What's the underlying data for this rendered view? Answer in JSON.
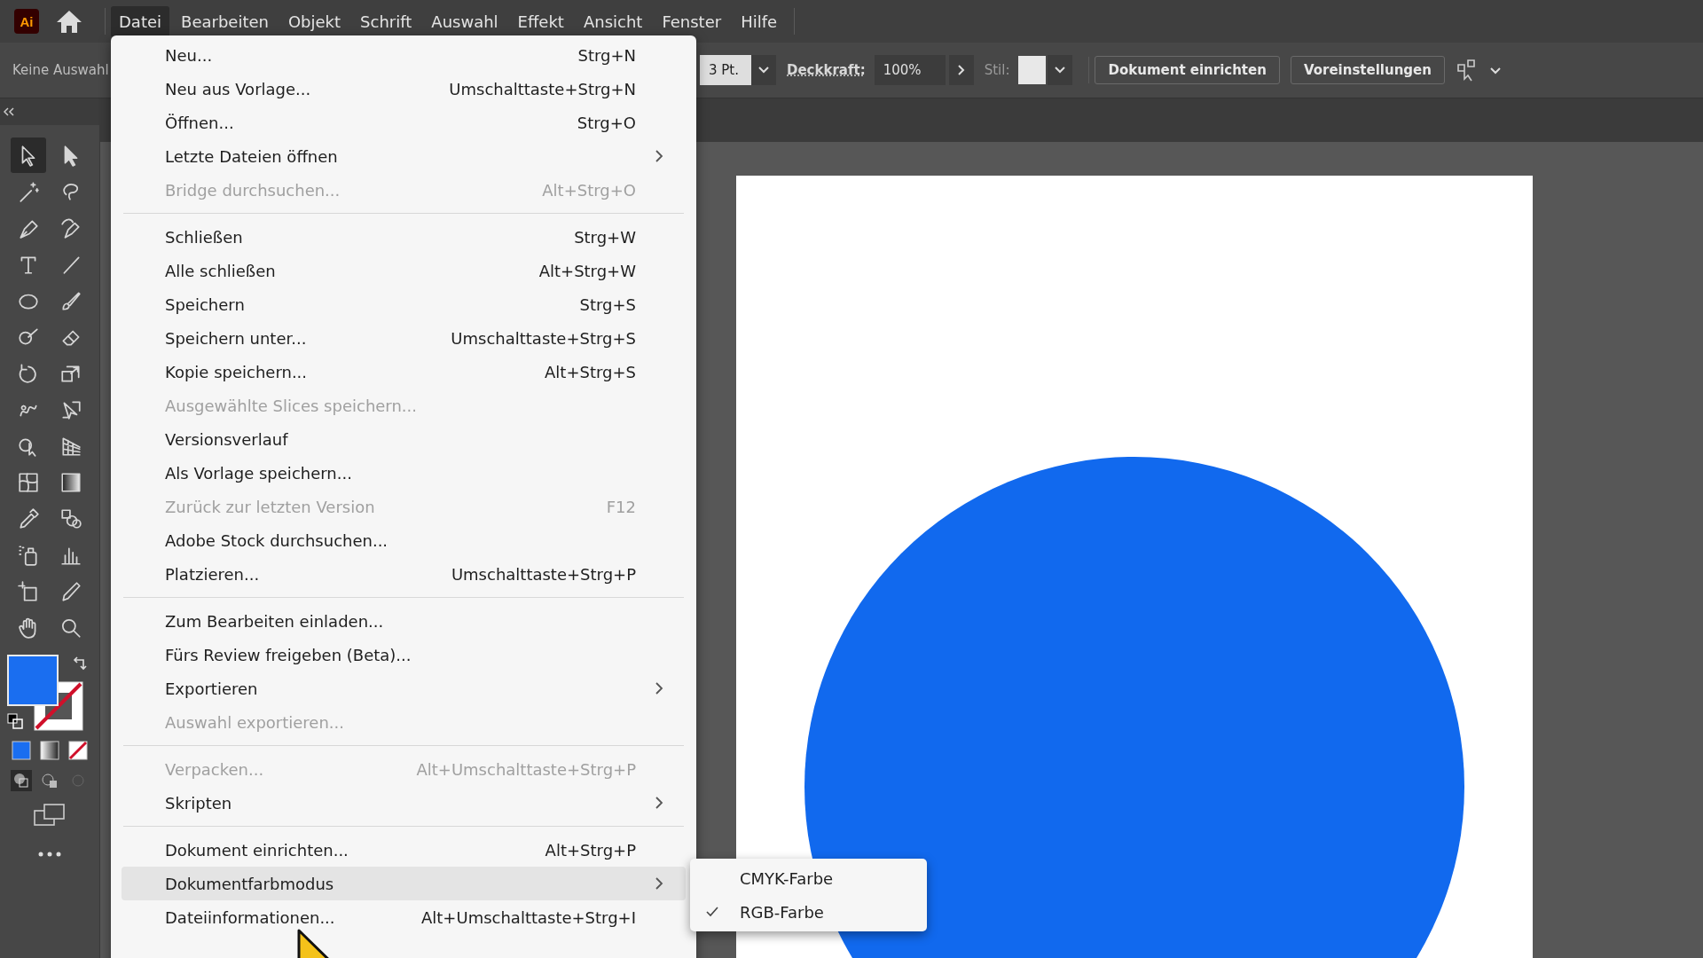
{
  "app_logo": "Ai",
  "menubar": [
    {
      "label": "Datei",
      "selected": true
    },
    {
      "label": "Bearbeiten",
      "selected": false
    },
    {
      "label": "Objekt",
      "selected": false
    },
    {
      "label": "Schrift",
      "selected": false
    },
    {
      "label": "Auswahl",
      "selected": false
    },
    {
      "label": "Effekt",
      "selected": false
    },
    {
      "label": "Ansicht",
      "selected": false
    },
    {
      "label": "Fenster",
      "selected": false
    },
    {
      "label": "Hilfe",
      "selected": false
    }
  ],
  "control_bar": {
    "selection": "Keine Auswahl",
    "stroke_weight": "3 Pt.",
    "opacity_label": "Deckkraft:",
    "opacity": "100%",
    "style_label": "Stil:",
    "buttons": [
      "Dokument einrichten",
      "Voreinstellungen"
    ]
  },
  "tools": [
    {
      "selected": true
    },
    {
      "selected": false
    },
    {
      "selected": false
    },
    {
      "selected": false
    },
    {
      "selected": false
    },
    {
      "selected": false
    },
    {
      "selected": false
    },
    {
      "selected": false
    },
    {
      "selected": false
    },
    {
      "selected": false
    },
    {
      "selected": false
    },
    {
      "selected": false
    },
    {
      "selected": false
    },
    {
      "selected": false
    },
    {
      "selected": false
    },
    {
      "selected": false
    },
    {
      "selected": false
    },
    {
      "selected": false
    },
    {
      "selected": false
    },
    {
      "selected": false
    },
    {
      "selected": false
    },
    {
      "selected": false
    },
    {
      "selected": false
    },
    {
      "selected": false
    },
    {
      "selected": false
    },
    {
      "selected": false
    },
    {
      "selected": false
    },
    {
      "selected": false
    }
  ],
  "file_menu": [
    {
      "kind": "item",
      "label": "Neu...",
      "shortcut": "Strg+N",
      "disabled": false,
      "submenu": false,
      "highlighted": false
    },
    {
      "kind": "item",
      "label": "Neu aus Vorlage...",
      "shortcut": "Umschalttaste+Strg+N",
      "disabled": false,
      "submenu": false,
      "highlighted": false
    },
    {
      "kind": "item",
      "label": "Öffnen...",
      "shortcut": "Strg+O",
      "disabled": false,
      "submenu": false,
      "highlighted": false
    },
    {
      "kind": "item",
      "label": "Letzte Dateien öffnen",
      "disabled": false,
      "submenu": true,
      "highlighted": false
    },
    {
      "kind": "item",
      "label": "Bridge durchsuchen...",
      "shortcut": "Alt+Strg+O",
      "disabled": true,
      "submenu": false,
      "highlighted": false
    },
    {
      "kind": "separator"
    },
    {
      "kind": "item",
      "label": "Schließen",
      "shortcut": "Strg+W",
      "disabled": false,
      "submenu": false,
      "highlighted": false
    },
    {
      "kind": "item",
      "label": "Alle schließen",
      "shortcut": "Alt+Strg+W",
      "disabled": false,
      "submenu": false,
      "highlighted": false
    },
    {
      "kind": "item",
      "label": "Speichern",
      "shortcut": "Strg+S",
      "disabled": false,
      "submenu": false,
      "highlighted": false
    },
    {
      "kind": "item",
      "label": "Speichern unter...",
      "shortcut": "Umschalttaste+Strg+S",
      "disabled": false,
      "submenu": false,
      "highlighted": false
    },
    {
      "kind": "item",
      "label": "Kopie speichern...",
      "shortcut": "Alt+Strg+S",
      "disabled": false,
      "submenu": false,
      "highlighted": false
    },
    {
      "kind": "item",
      "label": "Ausgewählte Slices speichern...",
      "disabled": true,
      "submenu": false,
      "highlighted": false
    },
    {
      "kind": "item",
      "label": "Versionsverlauf",
      "disabled": false,
      "submenu": false,
      "highlighted": false
    },
    {
      "kind": "item",
      "label": "Als Vorlage speichern...",
      "disabled": false,
      "submenu": false,
      "highlighted": false
    },
    {
      "kind": "item",
      "label": "Zurück zur letzten Version",
      "shortcut": "F12",
      "disabled": true,
      "submenu": false,
      "highlighted": false
    },
    {
      "kind": "item",
      "label": "Adobe Stock durchsuchen...",
      "disabled": false,
      "submenu": false,
      "highlighted": false
    },
    {
      "kind": "item",
      "label": "Platzieren...",
      "shortcut": "Umschalttaste+Strg+P",
      "disabled": false,
      "submenu": false,
      "highlighted": false
    },
    {
      "kind": "separator"
    },
    {
      "kind": "item",
      "label": "Zum Bearbeiten einladen...",
      "disabled": false,
      "submenu": false,
      "highlighted": false
    },
    {
      "kind": "item",
      "label": "Fürs Review freigeben (Beta)...",
      "disabled": false,
      "submenu": false,
      "highlighted": false
    },
    {
      "kind": "item",
      "label": "Exportieren",
      "disabled": false,
      "submenu": true,
      "highlighted": false
    },
    {
      "kind": "item",
      "label": "Auswahl exportieren...",
      "disabled": true,
      "submenu": false,
      "highlighted": false
    },
    {
      "kind": "separator"
    },
    {
      "kind": "item",
      "label": "Verpacken...",
      "shortcut": "Alt+Umschalttaste+Strg+P",
      "disabled": true,
      "submenu": false,
      "highlighted": false
    },
    {
      "kind": "item",
      "label": "Skripten",
      "disabled": false,
      "submenu": true,
      "highlighted": false
    },
    {
      "kind": "separator"
    },
    {
      "kind": "item",
      "label": "Dokument einrichten...",
      "shortcut": "Alt+Strg+P",
      "disabled": false,
      "submenu": false,
      "highlighted": false
    },
    {
      "kind": "item",
      "label": "Dokumentfarbmodus",
      "disabled": false,
      "submenu": true,
      "highlighted": true
    },
    {
      "kind": "item",
      "label": "Dateiinformationen...",
      "shortcut": "Alt+Umschalttaste+Strg+I",
      "disabled": false,
      "submenu": false,
      "highlighted": false
    }
  ],
  "color_mode_submenu": [
    {
      "label": "CMYK-Farbe",
      "checked": false
    },
    {
      "label": "RGB-Farbe",
      "checked": true
    }
  ]
}
